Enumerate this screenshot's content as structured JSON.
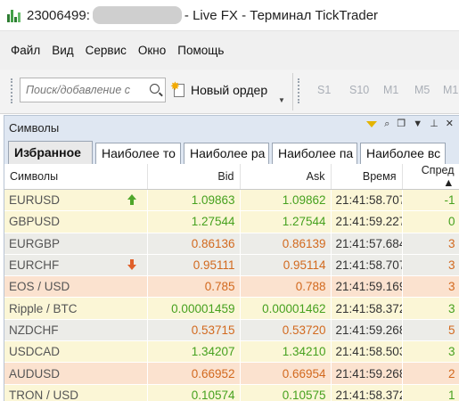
{
  "window": {
    "account": "23006499:",
    "title": "- Live FX - Терминал TickTrader"
  },
  "menu": [
    "Файл",
    "Вид",
    "Сервис",
    "Окно",
    "Помощь"
  ],
  "toolbar": {
    "search_placeholder": "Поиск/добавление с",
    "new_order_label": "Новый ордер",
    "periods": [
      "S1",
      "S10",
      "M1",
      "M5",
      "M1"
    ]
  },
  "panel": {
    "title": "Символы",
    "tabs": [
      "Избранное",
      "Наиболее то",
      "Наиболее ра",
      "Наиболее па",
      "Наиболее вс"
    ],
    "columns": {
      "symbol": "Символы",
      "bid": "Bid",
      "ask": "Ask",
      "time": "Время",
      "spread": "Спред ▲"
    },
    "rows": [
      {
        "symbol": "EURUSD",
        "bid": "1.09863",
        "ask": "1.09862",
        "time": "21:41:58.707",
        "spread": "-1",
        "trend": "up",
        "arrow": "up"
      },
      {
        "symbol": "GBPUSD",
        "bid": "1.27544",
        "ask": "1.27544",
        "time": "21:41:59.227",
        "spread": "0",
        "trend": "up",
        "arrow": ""
      },
      {
        "symbol": "EURGBP",
        "bid": "0.86136",
        "ask": "0.86139",
        "time": "21:41:57.684",
        "spread": "3",
        "trend": "down",
        "arrow": ""
      },
      {
        "symbol": "EURCHF",
        "bid": "0.95111",
        "ask": "0.95114",
        "time": "21:41:58.707",
        "spread": "3",
        "trend": "down",
        "arrow": "down"
      },
      {
        "symbol": "EOS / USD",
        "bid": "0.785",
        "ask": "0.788",
        "time": "21:41:59.169",
        "spread": "3",
        "trend": "down",
        "arrow": ""
      },
      {
        "symbol": "Ripple / BTC",
        "bid": "0.00001459",
        "ask": "0.00001462",
        "time": "21:41:58.372",
        "spread": "3",
        "trend": "up",
        "arrow": ""
      },
      {
        "symbol": "NZDCHF",
        "bid": "0.53715",
        "ask": "0.53720",
        "time": "21:41:59.268",
        "spread": "5",
        "trend": "down",
        "arrow": ""
      },
      {
        "symbol": "USDCAD",
        "bid": "1.34207",
        "ask": "1.34210",
        "time": "21:41:58.503",
        "spread": "3",
        "trend": "up",
        "arrow": ""
      },
      {
        "symbol": "AUDUSD",
        "bid": "0.66952",
        "ask": "0.66954",
        "time": "21:41:59.268",
        "spread": "2",
        "trend": "down",
        "arrow": ""
      },
      {
        "symbol": "TRON / USD",
        "bid": "0.10574",
        "ask": "0.10575",
        "time": "21:41:58.372",
        "spread": "1",
        "trend": "up",
        "arrow": ""
      }
    ]
  },
  "colors": {
    "up_text": "#46a11e",
    "down_text": "#d2691e",
    "up_row_bg": "#fbf6d6",
    "down_row_bg": "#fbe2cf",
    "neutral_row_bg": "#ecece8",
    "accent_header": "#dfe7f2"
  }
}
